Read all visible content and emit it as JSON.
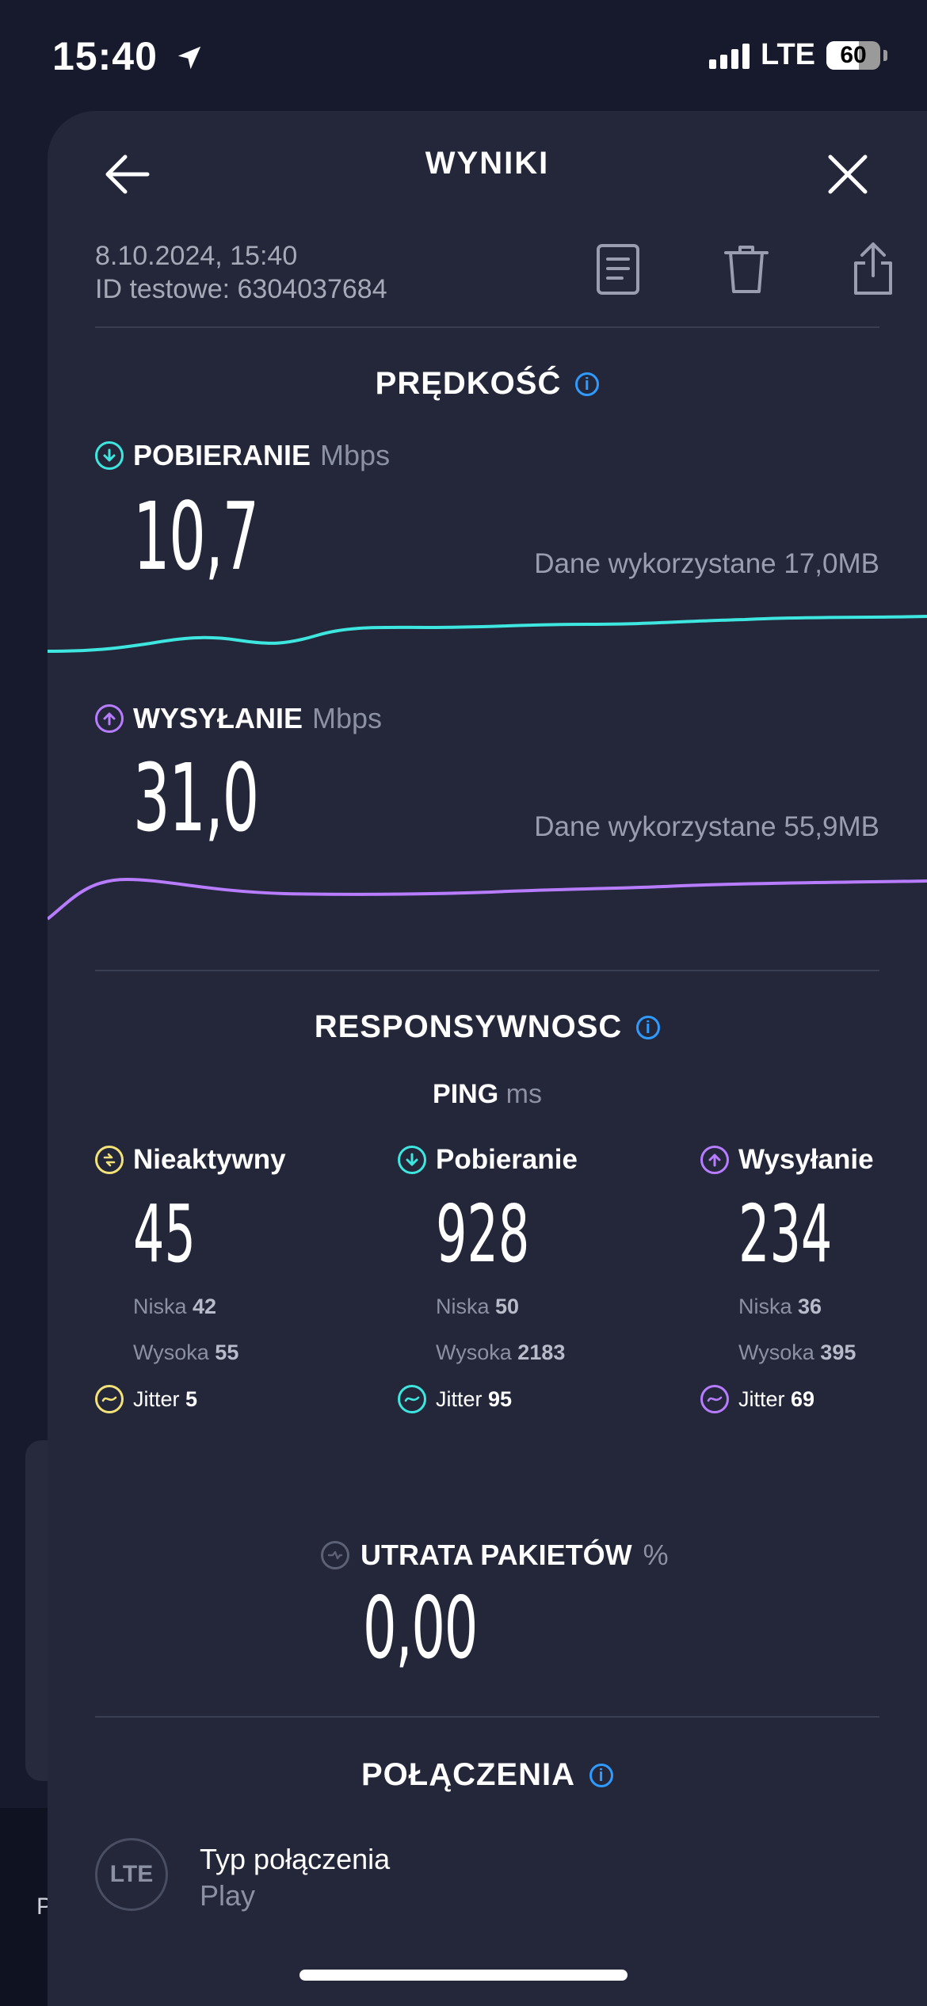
{
  "status_bar": {
    "time": "15:40",
    "network": "LTE",
    "battery": "60"
  },
  "background": {
    "peek_letter": "P"
  },
  "header": {
    "title": "WYNIKI"
  },
  "meta": {
    "date": "8.10.2024, 15:40",
    "test_id": "ID testowe: 6304037684"
  },
  "speed": {
    "title": "PRĘDKOŚĆ",
    "download": {
      "label": "POBIERANIE",
      "unit": "Mbps",
      "value": "10,7",
      "used": "Dane wykorzystane 17,0MB"
    },
    "upload": {
      "label": "WYSYŁANIE",
      "unit": "Mbps",
      "value": "31,0",
      "used": "Dane wykorzystane 55,9MB"
    }
  },
  "responsiveness": {
    "title": "RESPONSYWNOSC",
    "ping_label": "PING",
    "ping_unit": "ms",
    "columns": [
      {
        "label": "Nieaktywny",
        "value": "45",
        "low_label": "Niska",
        "low": "42",
        "high_label": "Wysoka",
        "high": "55",
        "jitter_label": "Jitter",
        "jitter": "5"
      },
      {
        "label": "Pobieranie",
        "value": "928",
        "low_label": "Niska",
        "low": "50",
        "high_label": "Wysoka",
        "high": "2183",
        "jitter_label": "Jitter",
        "jitter": "95"
      },
      {
        "label": "Wysyłanie",
        "value": "234",
        "low_label": "Niska",
        "low": "36",
        "high_label": "Wysoka",
        "high": "395",
        "jitter_label": "Jitter",
        "jitter": "69"
      }
    ]
  },
  "packet_loss": {
    "label": "UTRATA PAKIETÓW",
    "unit": "%",
    "value": "0,00"
  },
  "connections": {
    "title": "POŁĄCZENIA",
    "icon_text": "LTE",
    "type_label": "Typ połączenia",
    "provider": "Play"
  },
  "colors": {
    "download": "#3ee6e0",
    "upload": "#b77cff",
    "idle": "#f3e27a",
    "info": "#2f9bff"
  }
}
